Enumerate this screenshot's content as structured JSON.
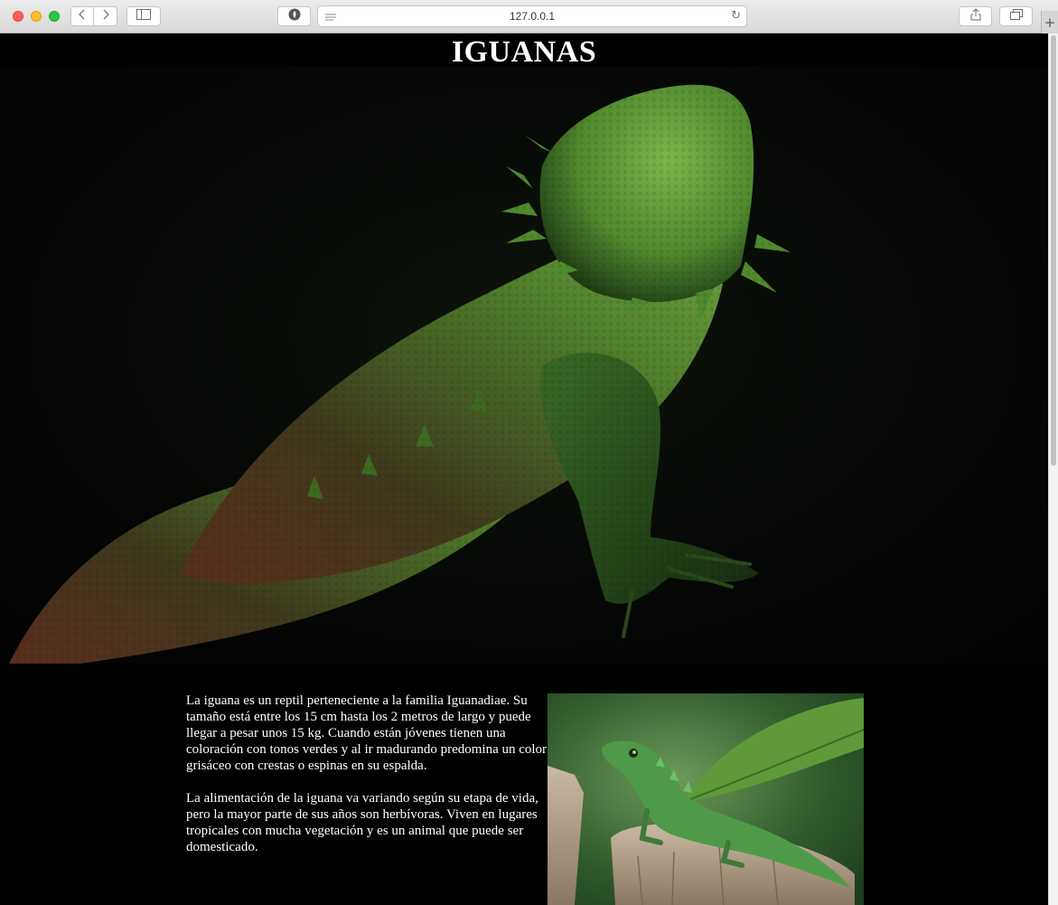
{
  "browser": {
    "url": "127.0.0.1",
    "back_icon": "chevron-left-icon",
    "forward_icon": "chevron-right-icon",
    "sidebar_icon": "sidebar-icon",
    "shield_icon": "shield-icon",
    "reader_icon": "reader-lines-icon",
    "reload_icon": "reload-icon",
    "share_icon": "share-icon",
    "tabs_icon": "tabs-icon",
    "new_tab_icon": "plus-icon"
  },
  "page": {
    "title": "IGUANAS",
    "paragraph1": "La iguana es un reptil perteneciente a la familia Iguanadiae. Su tamaño está entre los 15 cm hasta los 2 metros de largo y puede llegar a pesar unos 15 kg. Cuando están jóvenes tienen una coloración con tonos verdes y al ir madurando predomina un color grisáceo con crestas o espinas en su espalda.",
    "paragraph2": "La alimentación de la iguana va variando según su etapa de vida, pero la mayor parte de sus años son herbívoras. Viven en lugares tropicales con mucha vegetación y es un animal que puede ser domesticado."
  },
  "colors": {
    "background": "#000000",
    "text": "#ffffff",
    "lizard_green": "#4f8a2e",
    "lizard_brown": "#6a3a22"
  }
}
